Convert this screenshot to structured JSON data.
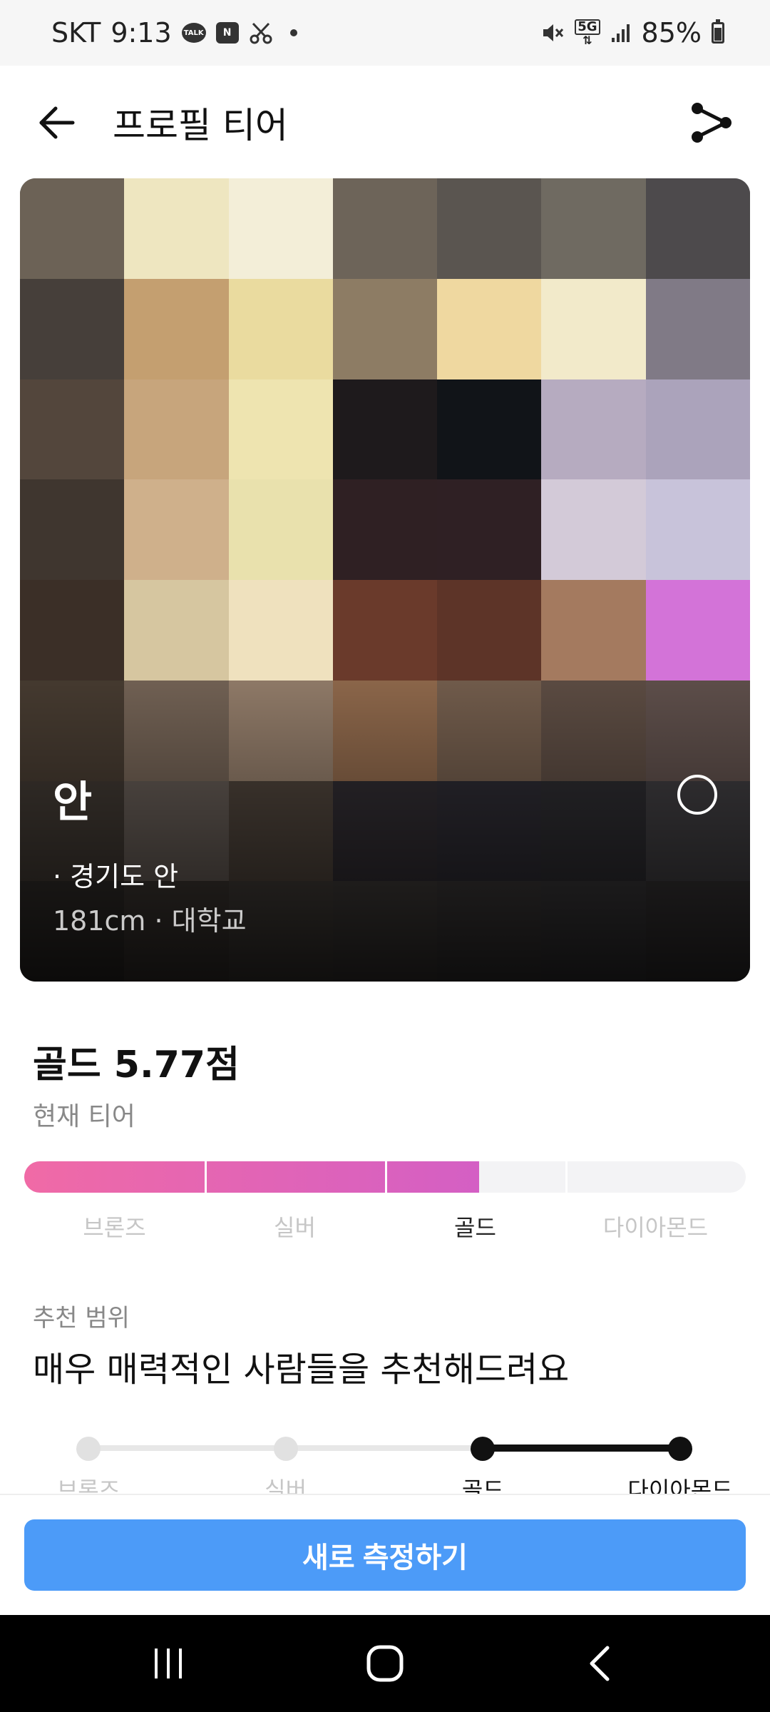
{
  "status_bar": {
    "carrier": "SKT",
    "time": "9:13",
    "talk_badge": "TALK",
    "mail_badge": "N",
    "network": "5G",
    "battery": "85%"
  },
  "header": {
    "title": "프로필 티어"
  },
  "profile": {
    "name": "안",
    "line1": "· 경기도 안",
    "line2": "181cm · 대학교",
    "photo_pixels": [
      "#6c6256",
      "#eee6c0",
      "#f3eed8",
      "#6d6459",
      "#5a5550",
      "#6f6a61",
      "#4d4a4c",
      "#463f3a",
      "#c49f70",
      "#eadb9f",
      "#8d7c64",
      "#efd8a0",
      "#f2eaca",
      "#807a86",
      "#53463c",
      "#c7a57c",
      "#eee4b0",
      "#1e1a1c",
      "#111418",
      "#b6abc0",
      "#aba3bb",
      "#3f362f",
      "#cfb08b",
      "#e9e1ad",
      "#2f2023",
      "#2f2024",
      "#d3cad8",
      "#c8c3da",
      "#3b2f27",
      "#d6c6a0",
      "#efe1be",
      "#6a3a2b",
      "#5d3428",
      "#a47a5f",
      "#d373d8",
      "#44392f",
      "#6f5f52",
      "#8d7866",
      "#8a6549",
      "#6f5a4a",
      "#5a4a41",
      "#5c4d49",
      "#3d3630",
      "#5f5650",
      "#4a4038",
      "#2e2a2f",
      "#2b2930",
      "#2b2a2e",
      "#3c3a3d",
      "#2f2b28",
      "#3a3430",
      "#3f3a36",
      "#3c3836",
      "#383535",
      "#363436",
      "#333031"
    ]
  },
  "tier": {
    "score_title": "골드 5.77점",
    "caption": "현재 티어",
    "progress": 0.63,
    "labels": [
      "브론즈",
      "실버",
      "골드",
      "다이아몬드"
    ],
    "current_index": 2,
    "colors": {
      "fill_start": "#f06aa6",
      "fill_end": "#d45fc4",
      "track": "#f3f3f5"
    }
  },
  "recommendation": {
    "caption": "추천 범위",
    "text": "매우 매력적인 사람들을 추천해드려요",
    "labels": [
      "브론즈",
      "실버",
      "골드",
      "다이아몬드"
    ],
    "range": [
      2,
      3
    ]
  },
  "cta": {
    "label": "새로 측정하기",
    "color": "#4c9bf8"
  }
}
